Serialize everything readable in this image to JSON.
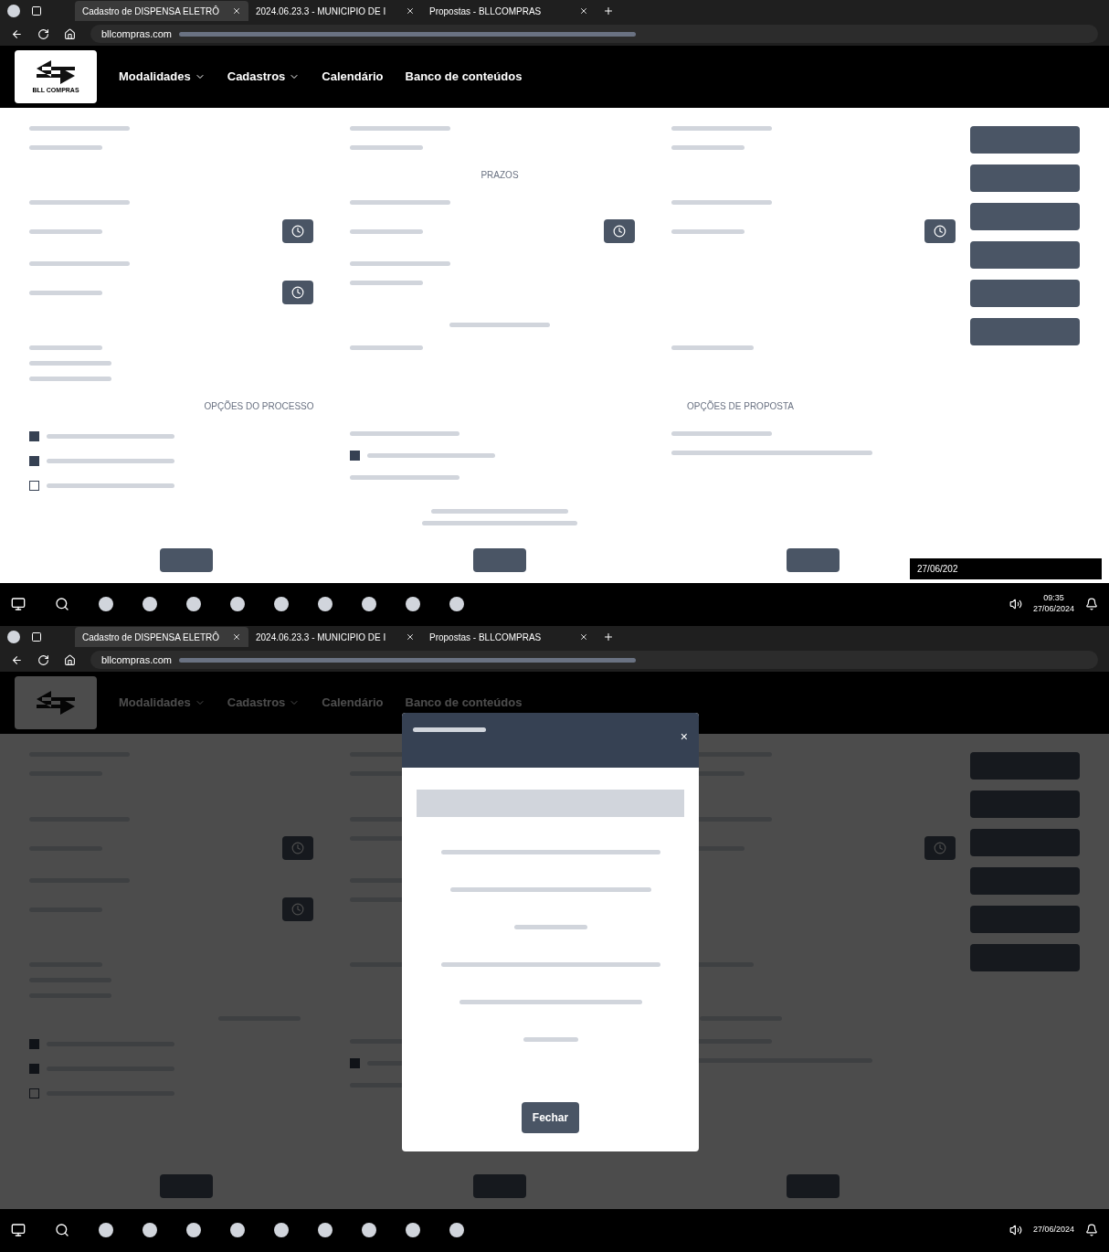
{
  "screens": [
    {
      "browser": {
        "tabs": [
          {
            "title": "Cadastro de DISPENSA ELETRÔ",
            "selected": true
          },
          {
            "title": "2024.06.23.3 - MUNICIPIO DE I",
            "selected": false
          },
          {
            "title": "Propostas - BLLCOMPRAS",
            "selected": false
          }
        ],
        "url": "bllcompras.com"
      },
      "app": {
        "logo": "BLL COMPRAS",
        "nav": [
          {
            "label": "Modalidades",
            "dropdown": true
          },
          {
            "label": "Cadastros",
            "dropdown": true
          },
          {
            "label": "Calendário",
            "dropdown": false
          },
          {
            "label": "Banco de conteúdos",
            "dropdown": false
          }
        ]
      },
      "form": {
        "headings": [
          "PRAZOS",
          "OPÇÕES DO PROCESSO",
          "OPÇÕES DE PROPOSTA"
        ],
        "checkboxes": [
          {
            "checked": true
          },
          {
            "checked": true
          },
          {
            "checked": false
          },
          {
            "checked": true
          }
        ]
      },
      "notification": "27/06/202",
      "taskbar": {
        "time": "09:35",
        "date": "27/06/2024"
      }
    },
    {
      "browser": {
        "tabs": [
          {
            "title": "Cadastro de DISPENSA ELETRÔ",
            "selected": true
          },
          {
            "title": "2024.06.23.3 - MUNICIPIO DE I",
            "selected": false
          },
          {
            "title": "Propostas - BLLCOMPRAS",
            "selected": false
          }
        ],
        "url": "bllcompras.com"
      },
      "app": {
        "nav": [
          {
            "label": "Modalidades",
            "dropdown": true
          },
          {
            "label": "Cadastros",
            "dropdown": true
          },
          {
            "label": "Calendário",
            "dropdown": false
          },
          {
            "label": "Banco de conteúdos",
            "dropdown": false
          }
        ]
      },
      "form": {
        "checkboxes": [
          {
            "checked": true
          },
          {
            "checked": true
          },
          {
            "checked": false
          },
          {
            "checked": true
          }
        ]
      },
      "modal": {
        "close": "×",
        "button": "Fechar"
      },
      "taskbar": {
        "date": "27/06/2024"
      }
    }
  ]
}
